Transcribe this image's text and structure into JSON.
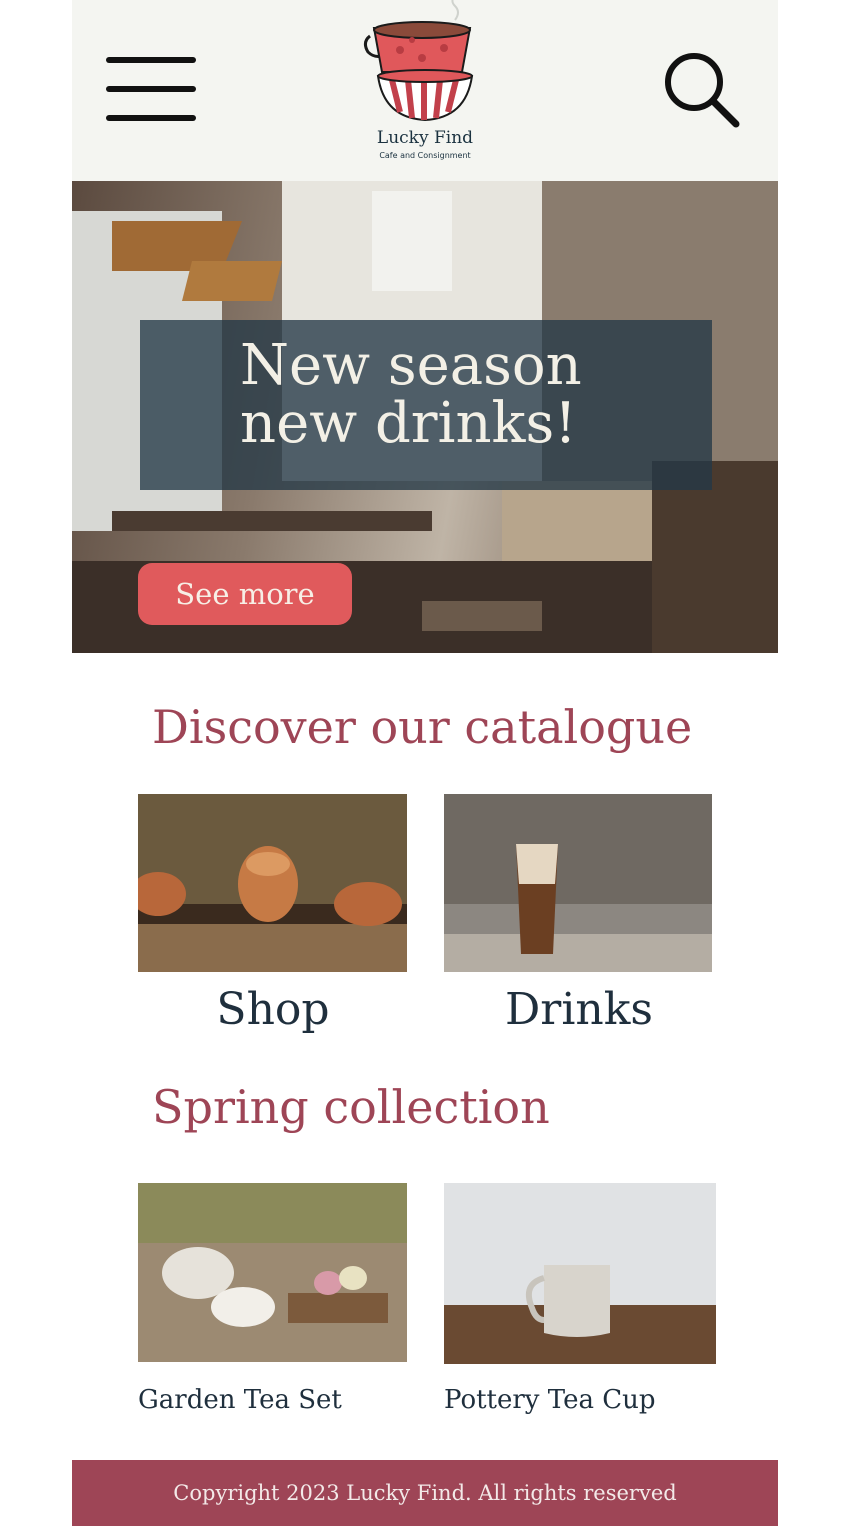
{
  "header": {
    "menu_icon": "hamburger-menu-icon",
    "search_icon": "magnifier-search-icon",
    "logo": {
      "name": "Lucky Find",
      "tagline": "Cafe and Consignment"
    }
  },
  "hero": {
    "title_line1": "New season",
    "title_line2": "new drinks!",
    "cta_label": "See more"
  },
  "catalogue": {
    "title": "Discover our catalogue",
    "items": [
      {
        "label": "Shop"
      },
      {
        "label": "Drinks"
      }
    ]
  },
  "spring": {
    "title": "Spring collection",
    "items": [
      {
        "label": "Garden Tea Set"
      },
      {
        "label": "Pottery Tea Cup"
      }
    ]
  },
  "footer": {
    "copyright": "Copyright 2023 Lucky Find. All rights reserved"
  },
  "colors": {
    "accent": "#9e4556",
    "button": "#e05a5c",
    "header_bg": "#f4f5f1",
    "text_dark": "#1f2f3d",
    "hero_band": "#243846"
  }
}
